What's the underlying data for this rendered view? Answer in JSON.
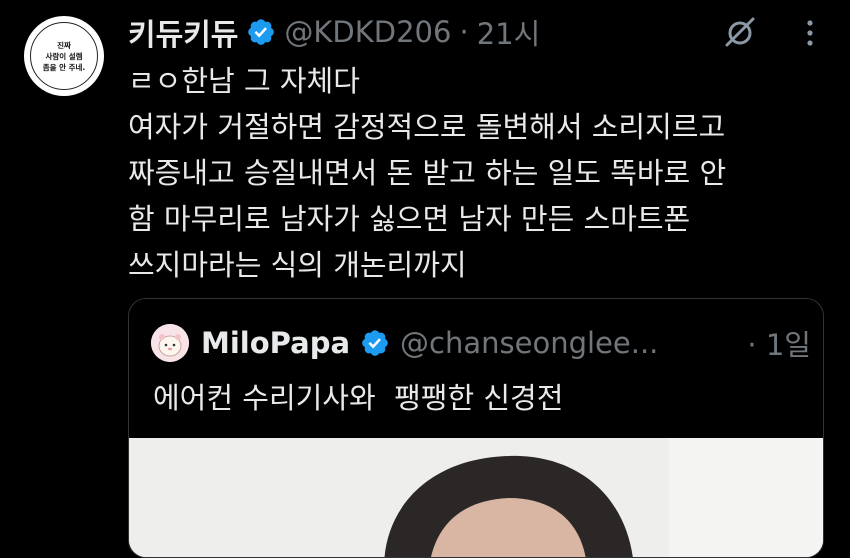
{
  "author": {
    "avatar_text": [
      "진짜",
      "사람이 설렘",
      "좀을 안 주네."
    ],
    "name": "키듀키듀",
    "handle": "@KDKD206",
    "separator": "·",
    "time": "21시"
  },
  "tweet": {
    "lines": [
      "ㄹㅇ한남 그 자체다",
      "여자가 거절하면 감정적으로 돌변해서 소리지르고",
      "짜증내고 승질내면서 돈 받고 하는 일도 똑바로 안",
      "함 마무리로 남자가 싫으면 남자 만든 스마트폰",
      "쓰지마라는 식의 개논리까지"
    ]
  },
  "quote": {
    "name": "MiloPapa",
    "handle": "@chanseonglee...",
    "time": "· 1일",
    "text": "에어컨 수리기사와  팽팽한 신경전"
  },
  "icons": {
    "verified": "verified-badge-icon",
    "hide": "eye-slash-icon",
    "more": "more-vertical-icon"
  },
  "colors": {
    "background": "#000000",
    "text": "#e7e9ea",
    "muted": "#71767b",
    "verified": "#1d9bf0",
    "border": "#2f3336"
  }
}
